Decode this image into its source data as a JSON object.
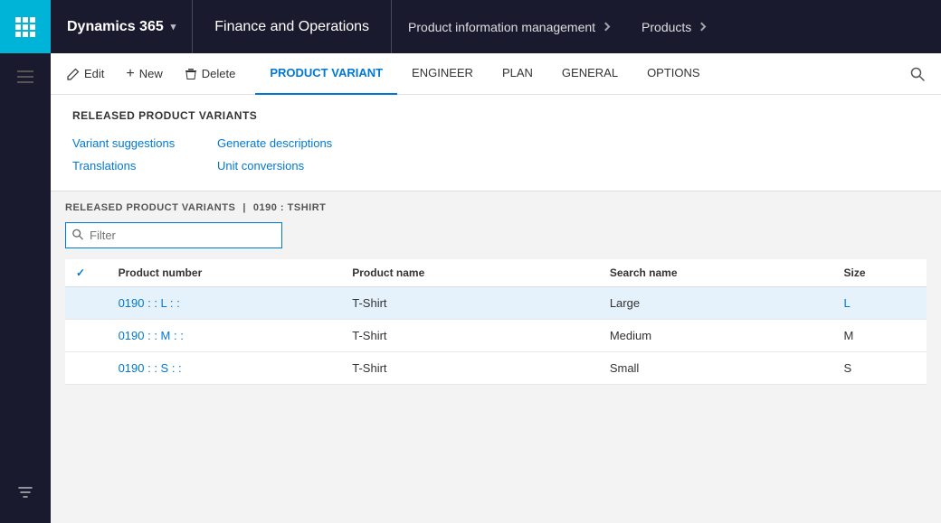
{
  "topNav": {
    "waffle_label": "App launcher",
    "dynamics_label": "Dynamics 365",
    "dynamics_chevron": "▾",
    "finance_label": "Finance and Operations",
    "pim_label": "Product information management",
    "products_label": "Products"
  },
  "toolbar": {
    "edit_label": "Edit",
    "new_label": "New",
    "delete_label": "Delete",
    "tabs": [
      {
        "id": "product-variant",
        "label": "PRODUCT VARIANT",
        "active": true
      },
      {
        "id": "engineer",
        "label": "ENGINEER",
        "active": false
      },
      {
        "id": "plan",
        "label": "PLAN",
        "active": false
      },
      {
        "id": "general",
        "label": "GENERAL",
        "active": false
      },
      {
        "id": "options",
        "label": "OPTIONS",
        "active": false
      }
    ]
  },
  "section": {
    "header": "RELEASED PRODUCT VARIANTS",
    "actions": [
      {
        "id": "variant-suggestions",
        "label": "Variant suggestions"
      },
      {
        "id": "generate-descriptions",
        "label": "Generate descriptions"
      },
      {
        "id": "translations",
        "label": "Translations"
      },
      {
        "id": "unit-conversions",
        "label": "Unit conversions"
      }
    ]
  },
  "lowerPanel": {
    "breadcrumb_section": "RELEASED PRODUCT VARIANTS",
    "breadcrumb_separator": "|",
    "breadcrumb_item": "0190 : TSHIRT",
    "filter_placeholder": "Filter"
  },
  "table": {
    "columns": [
      {
        "id": "check",
        "label": ""
      },
      {
        "id": "product-number",
        "label": "Product number"
      },
      {
        "id": "product-name",
        "label": "Product name"
      },
      {
        "id": "search-name",
        "label": "Search name"
      },
      {
        "id": "size",
        "label": "Size"
      }
    ],
    "rows": [
      {
        "id": "row-1",
        "product_number": "0190 : : L : :",
        "product_name": "T-Shirt",
        "search_name": "Large",
        "size": "L",
        "selected": true,
        "size_link": true
      },
      {
        "id": "row-2",
        "product_number": "0190 : : M : :",
        "product_name": "T-Shirt",
        "search_name": "Medium",
        "size": "M",
        "selected": false,
        "size_link": false
      },
      {
        "id": "row-3",
        "product_number": "0190 : : S : :",
        "product_name": "T-Shirt",
        "search_name": "Small",
        "size": "S",
        "selected": false,
        "size_link": false
      }
    ]
  },
  "icons": {
    "waffle": "⊞",
    "edit": "✏",
    "new_plus": "+",
    "delete": "🗑",
    "search": "🔍",
    "funnel": "▼",
    "check": "✓",
    "hamburger": "☰"
  }
}
